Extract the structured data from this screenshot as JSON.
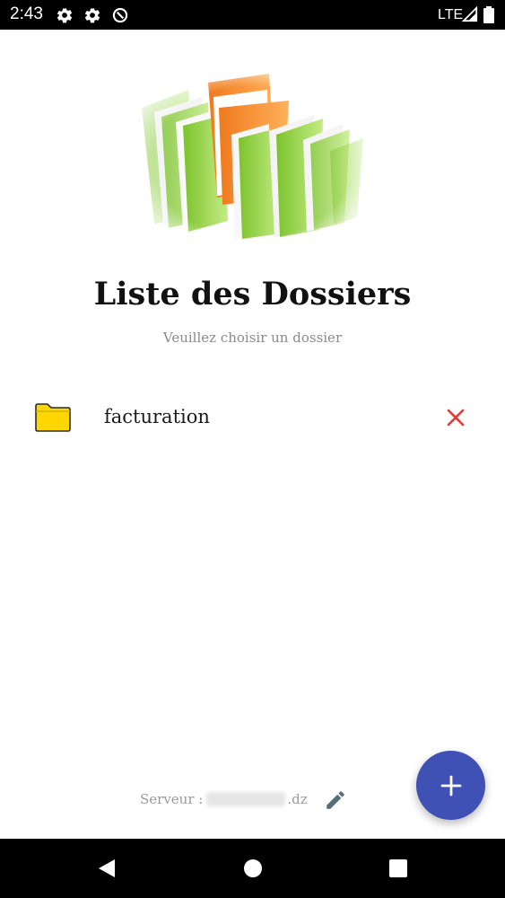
{
  "status_bar": {
    "time": "2:43",
    "network": "LTE",
    "icons": [
      "settings-icon",
      "settings-icon",
      "data-saver-icon",
      "signal-icon",
      "battery-icon"
    ]
  },
  "header": {
    "title": "Liste des Dossiers",
    "subtitle": "Veuillez choisir un dossier"
  },
  "folders": [
    {
      "name": "facturation",
      "icon": "folder-icon",
      "action_icon": "delete-icon"
    }
  ],
  "footer": {
    "server_label": "Serveur :",
    "server_suffix": ".dz",
    "edit_icon": "pencil-icon"
  },
  "fab": {
    "icon": "plus-icon"
  },
  "nav_bar": {
    "icons": [
      "back-icon",
      "home-icon",
      "recents-icon"
    ]
  },
  "colors": {
    "accent": "#3f51b5",
    "delete": "#e53935",
    "folder": "#ffd600",
    "subtitle": "#8a8a8a"
  }
}
